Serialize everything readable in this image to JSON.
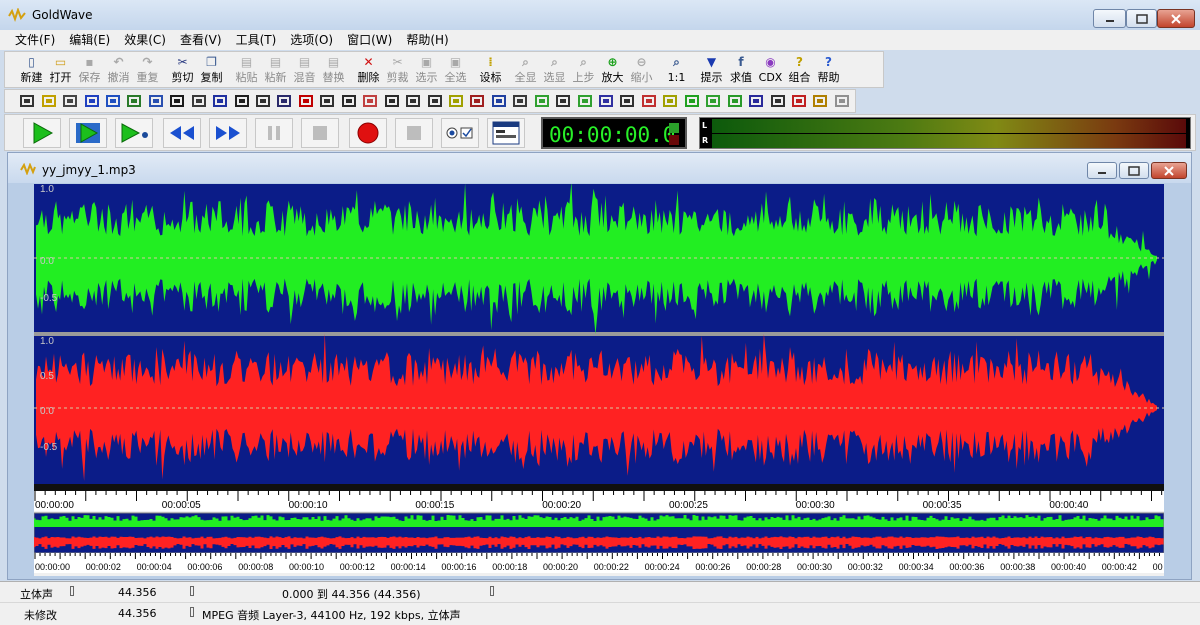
{
  "app": {
    "title": "GoldWave"
  },
  "menu": [
    "文件(F)",
    "编辑(E)",
    "效果(C)",
    "查看(V)",
    "工具(T)",
    "选项(O)",
    "窗口(W)",
    "帮助(H)"
  ],
  "toolbar": [
    {
      "label": "新建",
      "icon": "new-file-icon",
      "enabled": true
    },
    {
      "label": "打开",
      "icon": "open-folder-icon",
      "enabled": true
    },
    {
      "label": "保存",
      "icon": "save-icon",
      "enabled": false
    },
    {
      "label": "撤消",
      "icon": "undo-icon",
      "enabled": false
    },
    {
      "label": "重复",
      "icon": "redo-icon",
      "enabled": false
    },
    {
      "label": "剪切",
      "icon": "scissors-icon",
      "enabled": true
    },
    {
      "label": "复制",
      "icon": "copy-icon",
      "enabled": true
    },
    {
      "label": "粘贴",
      "icon": "paste-icon",
      "enabled": false
    },
    {
      "label": "粘新",
      "icon": "paste-new-icon",
      "enabled": false
    },
    {
      "label": "混音",
      "icon": "mix-icon",
      "enabled": false
    },
    {
      "label": "替换",
      "icon": "replace-icon",
      "enabled": false
    },
    {
      "label": "删除",
      "icon": "delete-icon",
      "enabled": true
    },
    {
      "label": "剪裁",
      "icon": "trim-icon",
      "enabled": false
    },
    {
      "label": "选示",
      "icon": "select-view-icon",
      "enabled": false
    },
    {
      "label": "全选",
      "icon": "select-all-icon",
      "enabled": false
    },
    {
      "label": "设标",
      "icon": "set-marker-icon",
      "enabled": true
    },
    {
      "label": "全显",
      "icon": "zoom-all-icon",
      "enabled": false
    },
    {
      "label": "选显",
      "icon": "zoom-selection-icon",
      "enabled": false
    },
    {
      "label": "上步",
      "icon": "zoom-previous-icon",
      "enabled": false
    },
    {
      "label": "放大",
      "icon": "zoom-in-icon",
      "enabled": true
    },
    {
      "label": "缩小",
      "icon": "zoom-out-icon",
      "enabled": false
    },
    {
      "label": "1:1",
      "icon": "zoom-1-1-icon",
      "enabled": true
    },
    {
      "label": "提示",
      "icon": "cue-icon",
      "enabled": true
    },
    {
      "label": "求值",
      "icon": "expression-icon",
      "enabled": true
    },
    {
      "label": "CDX",
      "icon": "cd-icon",
      "enabled": true
    },
    {
      "label": "组合",
      "icon": "combine-icon",
      "enabled": true
    },
    {
      "label": "帮助",
      "icon": "help-icon",
      "enabled": true
    }
  ],
  "time_display": "00:00:00.0",
  "meter_labels": {
    "left": "L",
    "right": "R"
  },
  "document": {
    "title": "yy_jmyy_1.mp3"
  },
  "channels": {
    "left_color": "#22ee22",
    "right_color": "#ff2222",
    "background": "#0b1c88",
    "left_ticks": [
      "1.0",
      "0.0",
      "-0.5"
    ],
    "right_ticks": [
      "1.0",
      "0.5",
      "0.0",
      "-0.5"
    ]
  },
  "timeline_labels": [
    "00:00:00",
    "00:00:05",
    "00:00:10",
    "00:00:15",
    "00:00:20",
    "00:00:25",
    "00:00:30",
    "00:00:35",
    "00:00:40"
  ],
  "overview_labels": [
    "00:00:00",
    "00:00:02",
    "00:00:04",
    "00:00:06",
    "00:00:08",
    "00:00:10",
    "00:00:12",
    "00:00:14",
    "00:00:16",
    "00:00:18",
    "00:00:20",
    "00:00:22",
    "00:00:24",
    "00:00:26",
    "00:00:28",
    "00:00:30",
    "00:00:32",
    "00:00:34",
    "00:00:36",
    "00:00:38",
    "00:00:40",
    "00:00:42",
    "00"
  ],
  "status": {
    "row1": {
      "mode": "立体声",
      "length": "44.356",
      "selection": "0.000 到 44.356 (44.356)"
    },
    "row2": {
      "state": "未修改",
      "length": "44.356",
      "format": "MPEG 音频 Layer-3, 44100 Hz, 192 kbps, 立体声"
    }
  }
}
